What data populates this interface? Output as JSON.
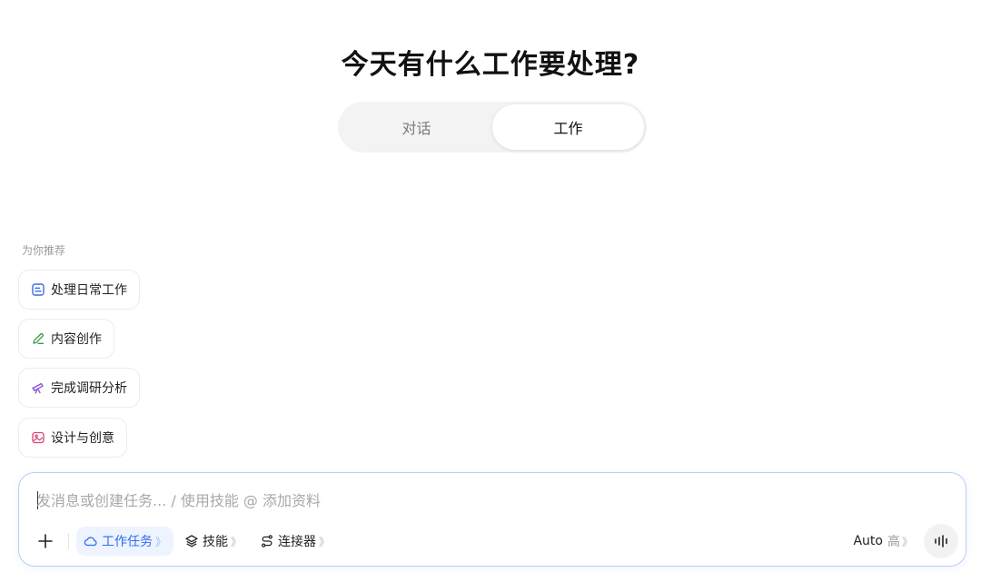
{
  "headline": "今天有什么工作要处理?",
  "mode_tabs": [
    {
      "label": "对话",
      "active": false
    },
    {
      "label": "工作",
      "active": true
    }
  ],
  "recommend": {
    "label": "为你推荐",
    "items": [
      {
        "label": "处理日常工作",
        "icon": "document-icon",
        "color": "#3b6fe0"
      },
      {
        "label": "内容创作",
        "icon": "pencil-icon",
        "color": "#3a9a47"
      },
      {
        "label": "完成调研分析",
        "icon": "telescope-icon",
        "color": "#8a4fd6"
      },
      {
        "label": "设计与创意",
        "icon": "image-icon",
        "color": "#d8457a"
      }
    ]
  },
  "composer": {
    "placeholder": "发消息或创建任务... / 使用技能 @ 添加资料",
    "tools": [
      {
        "label": "工作任务",
        "icon": "cloud-icon",
        "active": true
      },
      {
        "label": "技能",
        "icon": "layers-icon",
        "active": false
      },
      {
        "label": "连接器",
        "icon": "connector-icon",
        "active": false
      }
    ],
    "chevron": "》",
    "model": "Auto",
    "level": "高"
  },
  "colors": {
    "accent": "#2f6bf0",
    "composer_border": "#b9cdfb"
  }
}
